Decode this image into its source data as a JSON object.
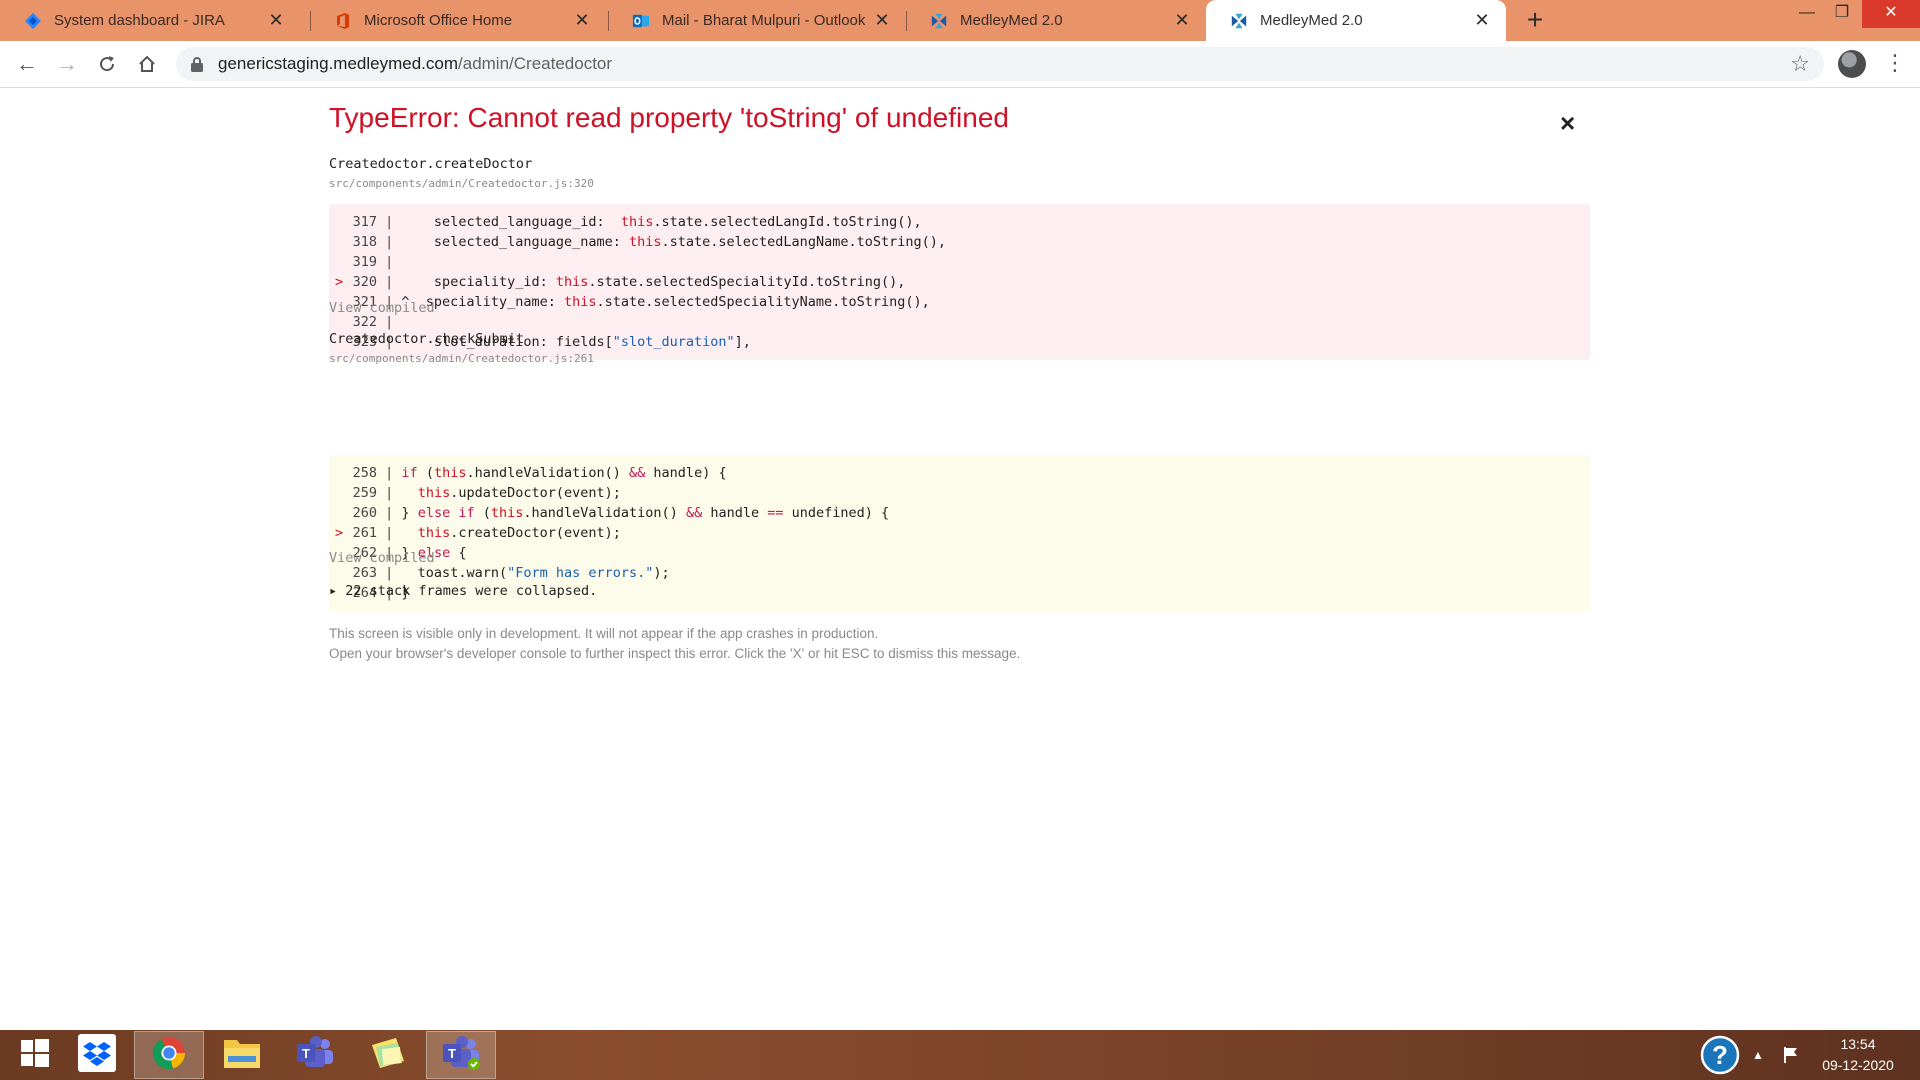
{
  "browser": {
    "tabs": [
      {
        "title": "System dashboard - JIRA",
        "icon": "jira-icon",
        "active": false
      },
      {
        "title": "Microsoft Office Home",
        "icon": "office-icon",
        "active": false
      },
      {
        "title": "Mail - Bharat Mulpuri - Outlook",
        "icon": "outlook-icon",
        "active": false
      },
      {
        "title": "MedleyMed 2.0",
        "icon": "medleymed-icon",
        "active": false
      },
      {
        "title": "MedleyMed 2.0",
        "icon": "medleymed-icon",
        "active": true
      }
    ],
    "new_tab": "+",
    "url_host": "genericstaging.medleymed.com",
    "url_path": "/admin/Createdoctor",
    "window_controls": {
      "minimize": "—",
      "maximize": "❐",
      "close": "✕"
    }
  },
  "error": {
    "title": "TypeError: Cannot read property 'toString' of undefined",
    "close_label": "×",
    "frames": [
      {
        "function": "Createdoctor.createDoctor",
        "file": "src/components/admin/Createdoctor.js:320",
        "kind": "error",
        "lines": [
          {
            "num": "317",
            "marker": "",
            "code": "    selected_language_id:  this.state.selectedLangId.toString(),"
          },
          {
            "num": "318",
            "marker": "",
            "code": "    selected_language_name: this.state.selectedLangName.toString(),"
          },
          {
            "num": "319",
            "marker": "",
            "code": ""
          },
          {
            "num": "320",
            "marker": ">",
            "code": "    speciality_id: this.state.selectedSpecialityId.toString(),"
          },
          {
            "num": "321",
            "marker": "",
            "code": " ^  speciality_name: this.state.selectedSpecialityName.toString(),"
          },
          {
            "num": "322",
            "marker": "",
            "code": ""
          },
          {
            "num": "323",
            "marker": "",
            "code": "    slot_duration: fields[\"slot_duration\"],"
          }
        ],
        "view_compiled": "View compiled"
      },
      {
        "function": "Createdoctor.checkSubmit",
        "file": "src/components/admin/Createdoctor.js:261",
        "kind": "warning",
        "lines": [
          {
            "num": "258",
            "marker": "",
            "code": "if (this.handleValidation() && handle) {"
          },
          {
            "num": "259",
            "marker": "",
            "code": "  this.updateDoctor(event);"
          },
          {
            "num": "260",
            "marker": "",
            "code": "} else if (this.handleValidation() && handle == undefined) {"
          },
          {
            "num": "261",
            "marker": ">",
            "code": "  this.createDoctor(event);"
          },
          {
            "num": "262",
            "marker": "",
            "code": "} else {"
          },
          {
            "num": "263",
            "marker": "",
            "code": "  toast.warn(\"Form has errors.\");"
          },
          {
            "num": "264",
            "marker": "",
            "code": "}"
          }
        ],
        "view_compiled": "View compiled"
      }
    ],
    "collapsed_frames": "▸ 22 stack frames were collapsed.",
    "footnote_line1": "This screen is visible only in development. It will not appear if the app crashes in production.",
    "footnote_line2": "Open your browser's developer console to further inspect this error.  Click the 'X' or hit ESC to dismiss this message."
  },
  "taskbar": {
    "apps": [
      {
        "name": "start-button",
        "icon": "windows-icon"
      },
      {
        "name": "dropbox",
        "icon": "dropbox-icon"
      },
      {
        "name": "chrome",
        "icon": "chrome-icon",
        "active": true
      },
      {
        "name": "file-explorer",
        "icon": "folder-icon"
      },
      {
        "name": "teams",
        "icon": "teams-icon"
      },
      {
        "name": "sticky-notes",
        "icon": "sticky-notes-icon"
      },
      {
        "name": "teams-2",
        "icon": "teams-icon",
        "active": true
      }
    ],
    "clock_time": "13:54",
    "clock_date": "09-12-2020"
  },
  "colors": {
    "tab_strip": "#e9936a",
    "error_red": "#ce1126",
    "error_bg": "#fdeff1",
    "warning_bg": "#fdfbea"
  }
}
